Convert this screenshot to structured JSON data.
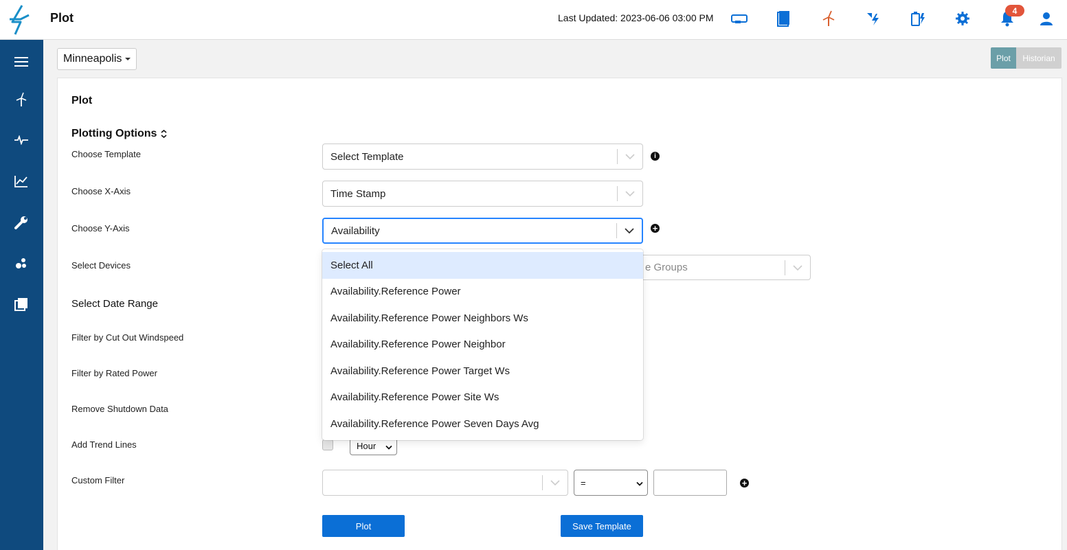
{
  "app": {
    "title": "Plot",
    "last_updated": "Last Updated: 2023-06-06 03:00 PM",
    "notification_count": "4"
  },
  "header_icons": [
    "controller-icon",
    "book-icon",
    "wind-turbine-icon",
    "lightning-sync-icon",
    "battery-bolt-icon",
    "gear-icon",
    "bell-icon",
    "user-icon"
  ],
  "sidebar_icons": [
    "menu-icon",
    "turbine-icon",
    "pulse-icon",
    "line-chart-icon",
    "wrench-icon",
    "nodes-icon",
    "library-icon"
  ],
  "site_selector": {
    "value": "Minneapolis"
  },
  "view_toggle": {
    "plot": "Plot",
    "historian": "Historian",
    "active": "Plot"
  },
  "card": {
    "title": "Plot",
    "section_title": "Plotting Options"
  },
  "form": {
    "choose_template": {
      "label": "Choose Template",
      "value": "Select Template"
    },
    "choose_x_axis": {
      "label": "Choose X-Axis",
      "value": "Time Stamp"
    },
    "choose_y_axis": {
      "label": "Choose Y-Axis",
      "value": "Availability"
    },
    "select_devices": {
      "label": "Select Devices",
      "groups_placeholder_visible": "e Groups"
    },
    "select_date_range": "Select Date Range",
    "filter_cut_out": "Filter by Cut Out Windspeed",
    "filter_rated_power": "Filter by Rated Power",
    "remove_shutdown": "Remove Shutdown Data",
    "add_trend_lines": {
      "label": "Add Trend Lines",
      "interval": "Hour",
      "checked": false
    },
    "custom_filter": {
      "label": "Custom Filter",
      "operator": "=",
      "value": ""
    }
  },
  "y_axis_menu": {
    "options": [
      "Select All",
      "Availability.Reference Power",
      "Availability.Reference Power Neighbors Ws",
      "Availability.Reference Power Neighbor",
      "Availability.Reference Power Target Ws",
      "Availability.Reference Power Site Ws",
      "Availability.Reference Power Seven Days Avg"
    ],
    "highlighted": 0
  },
  "buttons": {
    "plot": "Plot",
    "save_template": "Save Template"
  },
  "colors": {
    "sidebar": "#0f4a7e",
    "primary": "#0b6fd6",
    "badge": "#e2553b",
    "toggle_active": "#6b9fa8",
    "toggle_inactive": "#d0d0d0",
    "focus": "#2684ff",
    "menu_highlight": "#deebff"
  }
}
